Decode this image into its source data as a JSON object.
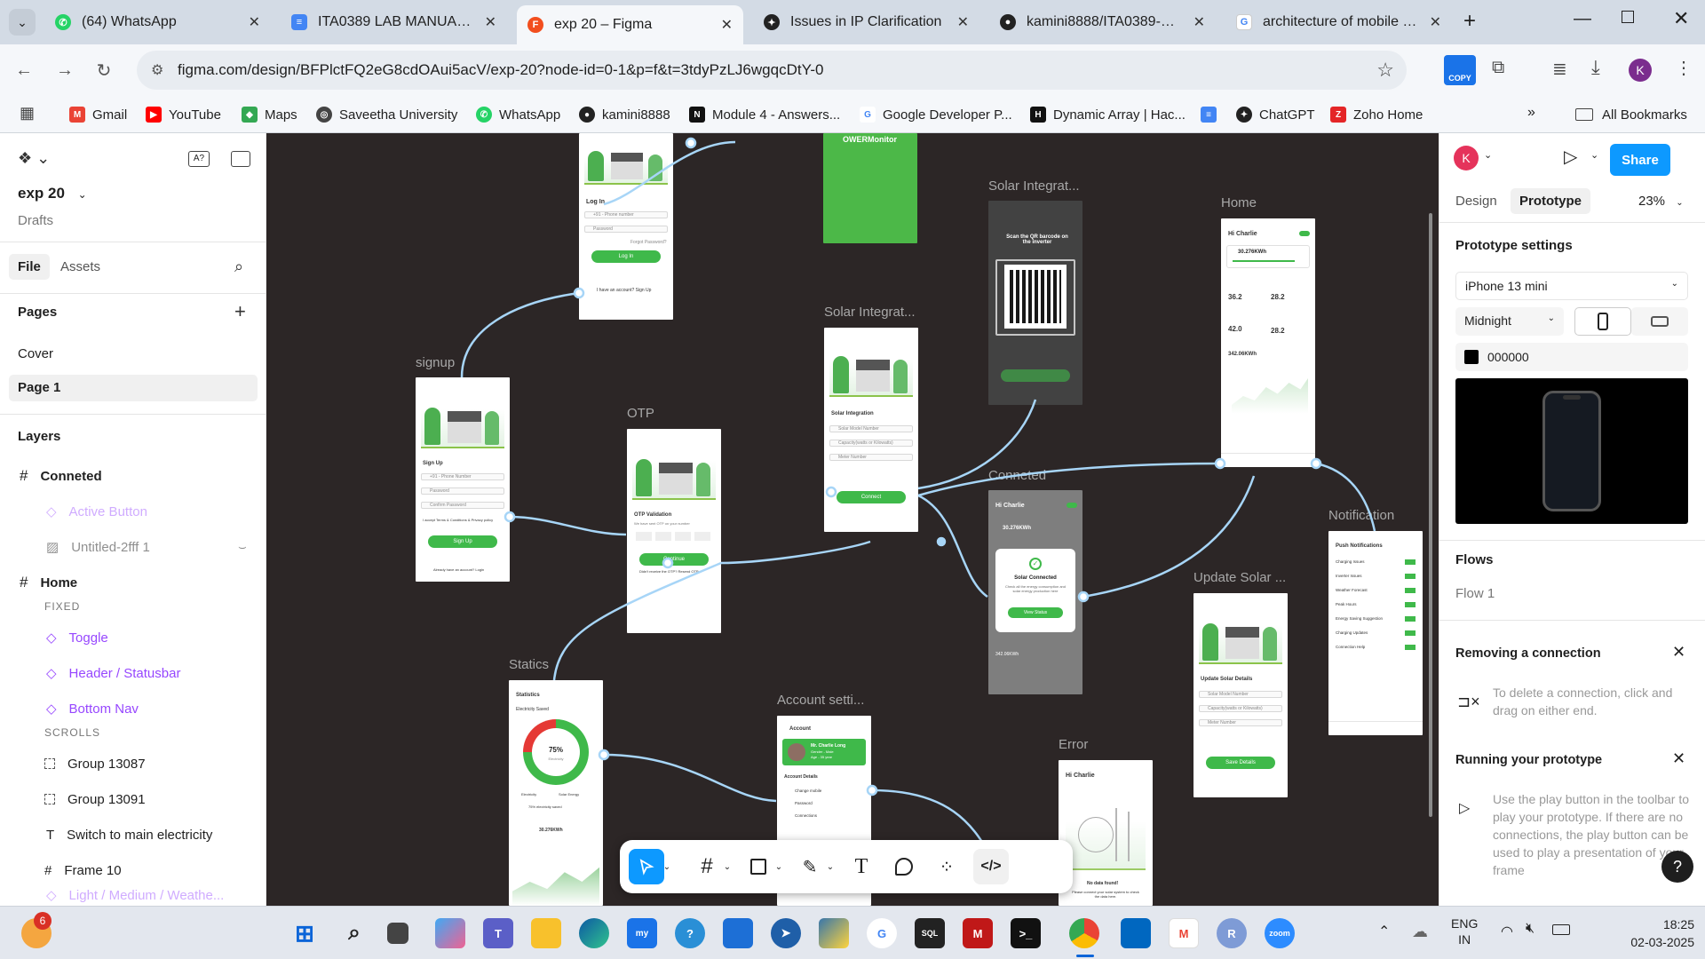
{
  "browser": {
    "tabs": [
      {
        "title": "(64) WhatsApp",
        "icon": "whatsapp-icon",
        "color": "#25d366"
      },
      {
        "title": "ITA0389 LAB MANUAL.doc",
        "icon": "docs-icon",
        "color": "#4285f4"
      },
      {
        "title": "exp 20 – Figma",
        "icon": "figma-icon",
        "color": "#f24e1e"
      },
      {
        "title": "Issues in IP Clarification",
        "icon": "chatgpt-icon",
        "color": "#222222"
      },
      {
        "title": "kamini8888/ITA0389-Mobi",
        "icon": "github-icon",
        "color": "#222222"
      },
      {
        "title": "architecture of mobile and",
        "icon": "google-icon",
        "color": "#4285f4"
      }
    ],
    "url": "figma.com/design/BFPlctFQ2eG8cdOAui5acV/exp-20?node-id=0-1&p=f&t=3tdyPzLJ6wgqcDtY-0",
    "copy_badge": "COPY",
    "profile_initial": "K",
    "bookmarks": [
      {
        "label": "Gmail",
        "color": "#ea4335"
      },
      {
        "label": "YouTube",
        "color": "#ff0000"
      },
      {
        "label": "Maps",
        "color": "#34a853"
      },
      {
        "label": "Saveetha University",
        "color": "#444444"
      },
      {
        "label": "WhatsApp",
        "color": "#25d366"
      },
      {
        "label": "kamini8888",
        "color": "#222222"
      },
      {
        "label": "Module 4 - Answers...",
        "color": "#111111"
      },
      {
        "label": "Google Developer P...",
        "color": "#4285f4"
      },
      {
        "label": "Dynamic Array | Hac...",
        "color": "#111111"
      },
      {
        "label": "",
        "color": "#4285f4"
      },
      {
        "label": "ChatGPT",
        "color": "#222222"
      },
      {
        "label": "Zoho Home",
        "color": "#e42527"
      }
    ],
    "all_bookmarks": "All Bookmarks"
  },
  "figma": {
    "file_name": "exp 20",
    "location": "Drafts",
    "left_tabs": {
      "file": "File",
      "assets": "Assets"
    },
    "pages_title": "Pages",
    "pages": [
      "Cover",
      "Page 1"
    ],
    "layers_title": "Layers",
    "layers": [
      {
        "label": "Conneted",
        "kind": "frame"
      },
      {
        "label": "Active Button",
        "kind": "component-faded"
      },
      {
        "label": "Untitled-2fff 1",
        "kind": "image-faded"
      },
      {
        "label": "Home",
        "kind": "frame"
      },
      {
        "label": "FIXED",
        "kind": "section"
      },
      {
        "label": "Toggle",
        "kind": "component"
      },
      {
        "label": "Header / Statusbar",
        "kind": "component"
      },
      {
        "label": "Bottom Nav",
        "kind": "component"
      },
      {
        "label": "SCROLLS",
        "kind": "section"
      },
      {
        "label": "Group 13087",
        "kind": "group"
      },
      {
        "label": "Group 13091",
        "kind": "group"
      },
      {
        "label": "Switch to main electricity",
        "kind": "text"
      },
      {
        "label": "Frame 10",
        "kind": "frame-child"
      },
      {
        "label": "Light / Medium / Weathe...",
        "kind": "component-faded"
      }
    ],
    "canvas_frames": {
      "monitor": "OWERMonitor",
      "solar1": "Solar Integrat...",
      "solar2": "Solar Integrat...",
      "home": "Home",
      "signup": "signup",
      "otp": "OTP",
      "conneted": "Conneted",
      "notification": "Notification",
      "update": "Update Solar ...",
      "statics": "Statics",
      "account": "Account setti...",
      "error": "Error"
    },
    "frame_text": {
      "login_title": "Log In",
      "login_phone": "+91 - Phone number",
      "login_password": "Password",
      "login_forgot": "Forgot Password?",
      "login_btn": "Log In",
      "login_footer": "I have an account? Sign Up",
      "signup_title": "Sign Up",
      "signup_phone": "+91 - Phone Number",
      "signup_password": "Password",
      "signup_confirm": "Confirm Password",
      "signup_terms": "I accept Terms & Conditions & Privacy policy",
      "signup_btn": "Sign Up",
      "signup_footer": "Already have an account? Login",
      "otp_title": "OTP Validation",
      "otp_sub": "We have sent OTP on your number",
      "otp_btn": "Continue",
      "otp_footer": "Didn't receive the OTP? Resend OTP",
      "solar_title": "Solar Integration",
      "solar_serial": "Solar Model Number",
      "solar_capacity": "Capacity(watts or Kilowatts)",
      "solar_meter": "Meter Number",
      "solar_btn": "Connect",
      "qr_title": "Scan the QR barcode on the inverter",
      "home_greeting": "Hi Charlie",
      "home_energy": "30.276KWh",
      "home_v1": "36.2",
      "home_v2": "28.2",
      "home_v3": "42.0",
      "home_v4": "28.2",
      "home_total": "342.06KWh",
      "conn_greeting": "Hi Charlie",
      "conn_energy": "30.276KWh",
      "conn_title": "Solar Connected",
      "conn_desc": "Check all the energy consumption and solar energy production here",
      "conn_btn": "View Status",
      "conn_total": "342.06KWh",
      "notif_title": "Push Notifications",
      "notif_items": [
        "Charging Issues",
        "Inverter Issues",
        "Weather Forecast",
        "Peak Hours",
        "Energy Saving Suggestion",
        "Charging Updates",
        "Connection Help"
      ],
      "update_title": "Update Solar Details",
      "update_serial": "Solar Model Number",
      "update_capacity": "Capacity(watts or Kilowatts)",
      "update_meter": "Meter Number",
      "update_btn": "Save Details",
      "stat_title": "Statistics",
      "stat_saved": "Electricity Saved",
      "stat_pct": "75%",
      "stat_unit": "Electricity",
      "stat_legend1": "Electricity",
      "stat_legend2": "Solar Energy",
      "stat_footer": "75% electricity saved",
      "stat_energy": "30.276KWh",
      "acc_title": "Account",
      "acc_name": "Mr. Charlie Long",
      "acc_gender": "Gender - Male",
      "acc_age": "Age - 35 year",
      "acc_details": "Account Details",
      "acc_items": [
        "Change mobile",
        "Password",
        "Connections"
      ],
      "err_greeting": "Hi Charlie",
      "err_nodata": "No data found!",
      "err_desc": "Please connect your solar system to check the data here."
    },
    "right": {
      "avatar": "K",
      "share": "Share",
      "tab_design": "Design",
      "tab_prototype": "Prototype",
      "zoom": "23%",
      "settings_title": "Prototype settings",
      "device": "iPhone 13 mini",
      "model": "Midnight",
      "bg_hex": "000000",
      "flows_title": "Flows",
      "flow1": "Flow 1",
      "remove_title": "Removing a connection",
      "remove_text": "To delete a connection, click and drag on either end.",
      "run_title": "Running your prototype",
      "run_text": "Use the play button in the toolbar to play your prototype. If there are no connections, the play button can be used to play a presentation of your frame",
      "help": "?"
    }
  },
  "taskbar": {
    "badge": "6",
    "lang1": "ENG",
    "lang2": "IN",
    "time": "18:25",
    "date": "02-03-2025"
  },
  "colors": {
    "accent": "#0d99ff",
    "green": "#3fb94a",
    "canvas": "#2c2626"
  }
}
